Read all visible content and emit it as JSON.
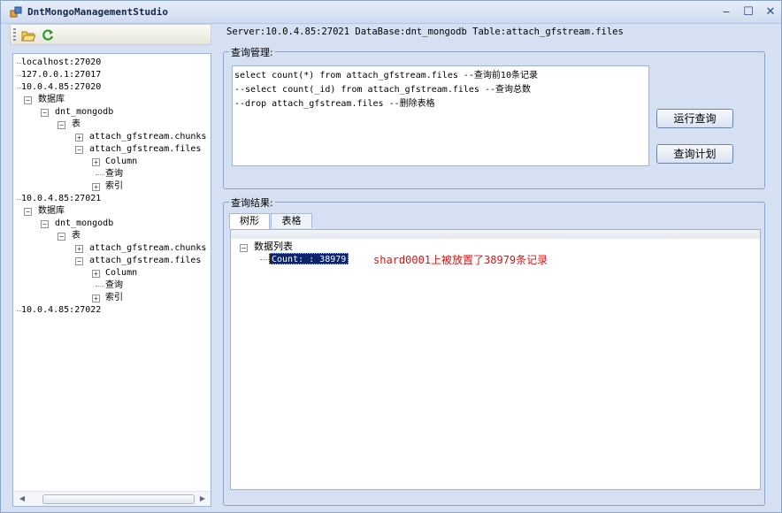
{
  "window": {
    "title": "DntMongoManagementStudio"
  },
  "toolbar": {
    "icons": [
      "open-folder-icon",
      "refresh-icon"
    ]
  },
  "server_info": "Server:10.0.4.85:27021 DataBase:dnt_mongodb Table:attach_gfstream.files",
  "tree": {
    "n1": "localhost:27020",
    "n2": "127.0.0.1:27017",
    "n3": "10.0.4.85:27020",
    "n4": "数据库",
    "n5": "dnt_mongodb",
    "n6": "表",
    "n7": "attach_gfstream.chunks",
    "n8": "attach_gfstream.files",
    "n9": "Column",
    "n10": "查询",
    "n11": "索引",
    "n12": "10.0.4.85:27021",
    "n13": "数据库",
    "n14": "dnt_mongodb",
    "n15": "表",
    "n16": "attach_gfstream.chunks",
    "n17": "attach_gfstream.files",
    "n18": "Column",
    "n19": "查询",
    "n20": "索引",
    "n21": "10.0.4.85:27022"
  },
  "query_group": {
    "legend": "查询管理:",
    "lines": [
      "select count(*) from attach_gfstream.files --查询前10条记录",
      "--select count(_id) from attach_gfstream.files --查询总数",
      "--drop attach_gfstream.files --删除表格"
    ],
    "run_button": "运行查询",
    "plan_button": "查询计划"
  },
  "result_group": {
    "legend": "查询结果:",
    "tabs": [
      "树形",
      "表格"
    ],
    "root": "数据列表",
    "count_item": "Count: : 38979",
    "note": "shard0001上被放置了38979条记录"
  }
}
